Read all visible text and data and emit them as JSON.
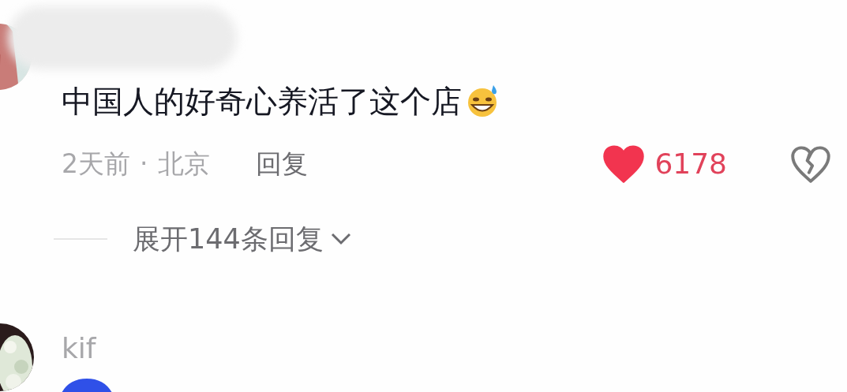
{
  "comments": [
    {
      "text": "中国人的好奇心养活了这个店",
      "time": "2天前",
      "separator": "·",
      "location": "北京",
      "reply": "回复",
      "likes": "6178",
      "liked": true,
      "disliked": false,
      "expand": "展开144条回复"
    },
    {
      "username": "kif"
    }
  ]
}
